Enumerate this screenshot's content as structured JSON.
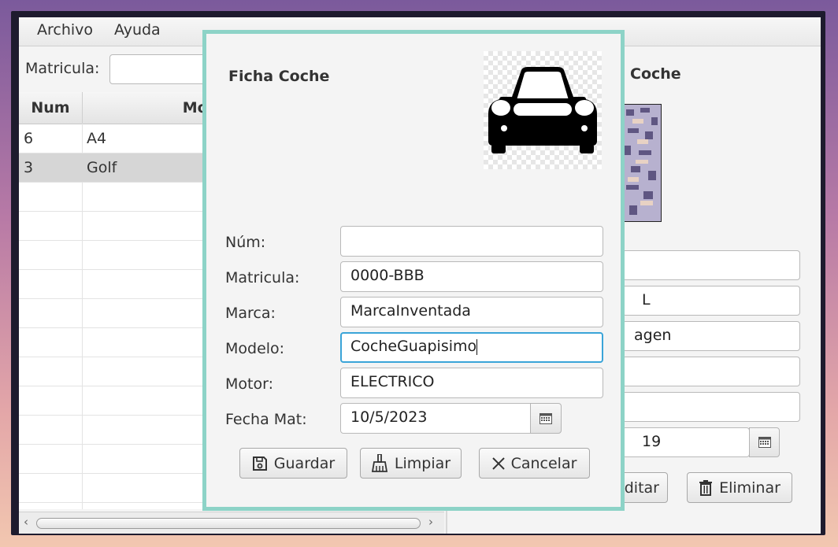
{
  "menu": {
    "file": "Archivo",
    "help": "Ayuda"
  },
  "search": {
    "label": "Matricula:",
    "value": ""
  },
  "table": {
    "headers": [
      "Num",
      "Mod"
    ],
    "rows": [
      {
        "num": "6",
        "model": "A4"
      },
      {
        "num": "3",
        "model": "Golf"
      }
    ]
  },
  "detail_panel": {
    "title": "Coche",
    "field2_partial": "L",
    "field3_partial": "agen",
    "date_partial": "19",
    "edit_button": "ditar",
    "delete_button": "Eliminar"
  },
  "dialog": {
    "title": "Ficha Coche",
    "fields": {
      "num": {
        "label": "Núm:",
        "value": ""
      },
      "plate": {
        "label": "Matricula:",
        "value": "0000-BBB"
      },
      "brand": {
        "label": "Marca:",
        "value": "MarcaInventada"
      },
      "model": {
        "label": "Modelo:",
        "value": "CocheGuapisimo"
      },
      "engine": {
        "label": "Motor:",
        "value": "ELECTRICO"
      },
      "date": {
        "label": "Fecha Mat:",
        "value": "10/5/2023"
      }
    },
    "buttons": {
      "save": "Guardar",
      "clear": "Limpiar",
      "cancel": "Cancelar"
    }
  },
  "icons": {
    "car": "car-front-icon",
    "calendar": "calendar-icon",
    "save": "floppy-disk-icon",
    "clear": "broom-icon",
    "cancel": "close-icon",
    "delete": "trash-icon"
  },
  "colors": {
    "dialog_border": "#8dd3c7",
    "focus": "#3aa4d8",
    "selected_row": "#d6d6d6"
  }
}
